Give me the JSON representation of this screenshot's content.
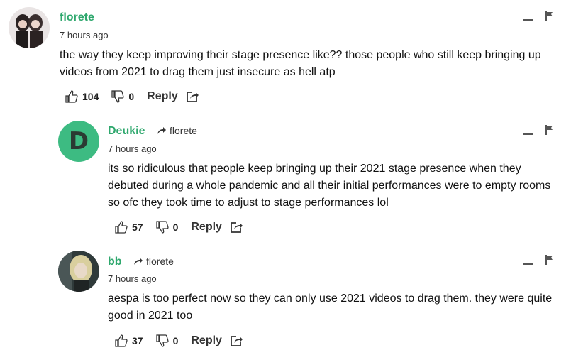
{
  "comments": [
    {
      "author": "florete",
      "reply_to": "",
      "time": "7 hours ago",
      "text": "the way they keep improving their stage presence like?? those people who still keep bringing up videos from 2021 to drag them just insecure as hell atp",
      "likes": "104",
      "dislikes": "0",
      "reply_label": "Reply"
    },
    {
      "author": "Deukie",
      "avatar_letter": "D",
      "reply_to": "florete",
      "time": "7 hours ago",
      "text": "its so ridiculous that people keep bringing up their 2021 stage presence when they debuted during a whole pandemic and all their initial performances were to empty rooms so ofc they took time to adjust to stage performances lol",
      "likes": "57",
      "dislikes": "0",
      "reply_label": "Reply"
    },
    {
      "author": "bb",
      "reply_to": "florete",
      "time": "7 hours ago",
      "text": "aespa is too perfect now so they can only use 2021 videos to drag them. they were quite good in 2021 too",
      "likes": "37",
      "dislikes": "0",
      "reply_label": "Reply"
    }
  ],
  "colors": {
    "author": "#2fa86e",
    "avatar_d": "#3dbb82"
  },
  "icons": [
    "thumbs-up-icon",
    "thumbs-down-icon",
    "share-icon",
    "collapse-icon",
    "flag-icon",
    "reply-arrow-icon"
  ]
}
